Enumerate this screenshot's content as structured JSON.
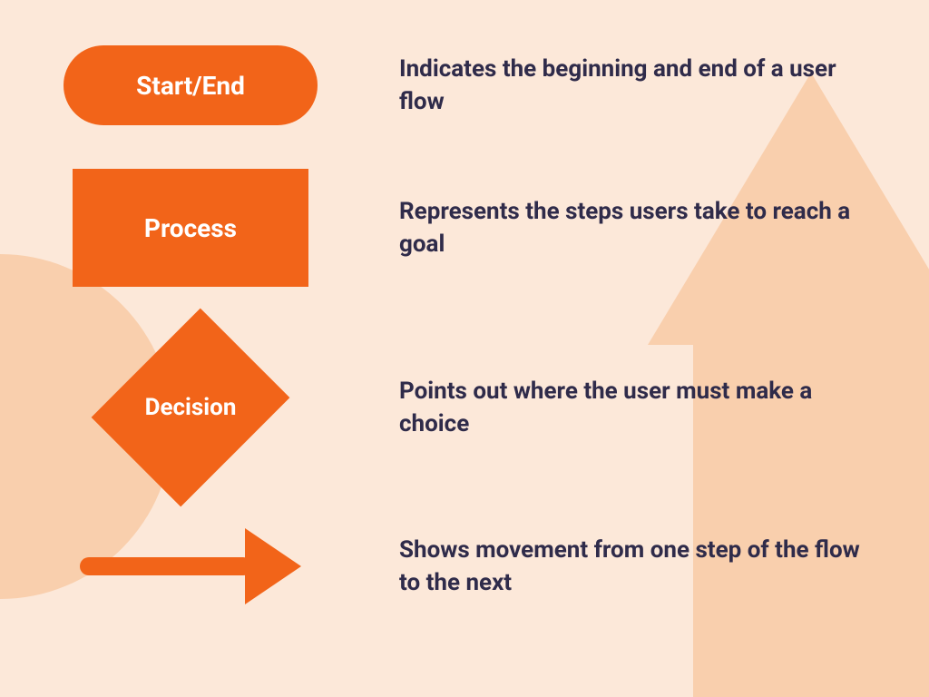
{
  "legend": [
    {
      "shape": "terminator",
      "label": "Start/End",
      "description": "Indicates the beginning and end of a user flow"
    },
    {
      "shape": "process",
      "label": "Process",
      "description": "Represents the steps users take to reach a goal"
    },
    {
      "shape": "decision",
      "label": "Decision",
      "description": "Points out where the user must make a choice"
    },
    {
      "shape": "arrow",
      "label": "",
      "description": "Shows movement from one step of the flow to the next"
    }
  ],
  "colors": {
    "shape_fill": "#f26419",
    "text": "#2f2b4a",
    "background": "#fce8d9",
    "accent_bg": "#f9cfad"
  }
}
